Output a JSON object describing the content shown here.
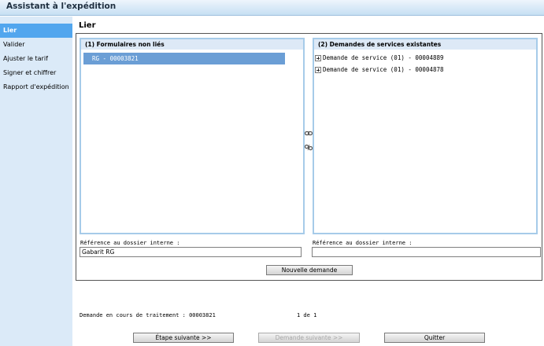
{
  "window": {
    "title": "Assistant à l'expédition"
  },
  "sidebar": {
    "items": [
      {
        "label": "Lier"
      },
      {
        "label": "Valider"
      },
      {
        "label": "Ajuster le tarif"
      },
      {
        "label": "Signer et chiffrer"
      },
      {
        "label": "Rapport d'expédition"
      }
    ]
  },
  "main": {
    "title": "Lier",
    "left_panel": {
      "header": "(1)  Formulaires non liés",
      "rows": [
        "RG   -   00003821"
      ],
      "reference_label": "Référence au dossier interne :",
      "reference_value": "Gabarit RG"
    },
    "right_panel": {
      "header": "(2)  Demandes de services existantes",
      "rows": [
        "Demande de service (01) - 00004889",
        "Demande de service (01) - 00004878"
      ],
      "reference_label": "Référence au dossier interne :",
      "reference_value": ""
    },
    "new_request_button": "Nouvelle demande"
  },
  "status": {
    "processing": "Demande en cours de traitement : 00003821",
    "page": "1 de 1"
  },
  "footer": {
    "next_step": "Étape suivante >>",
    "next_request": "Demande suivante >>",
    "quit": "Quitter"
  }
}
